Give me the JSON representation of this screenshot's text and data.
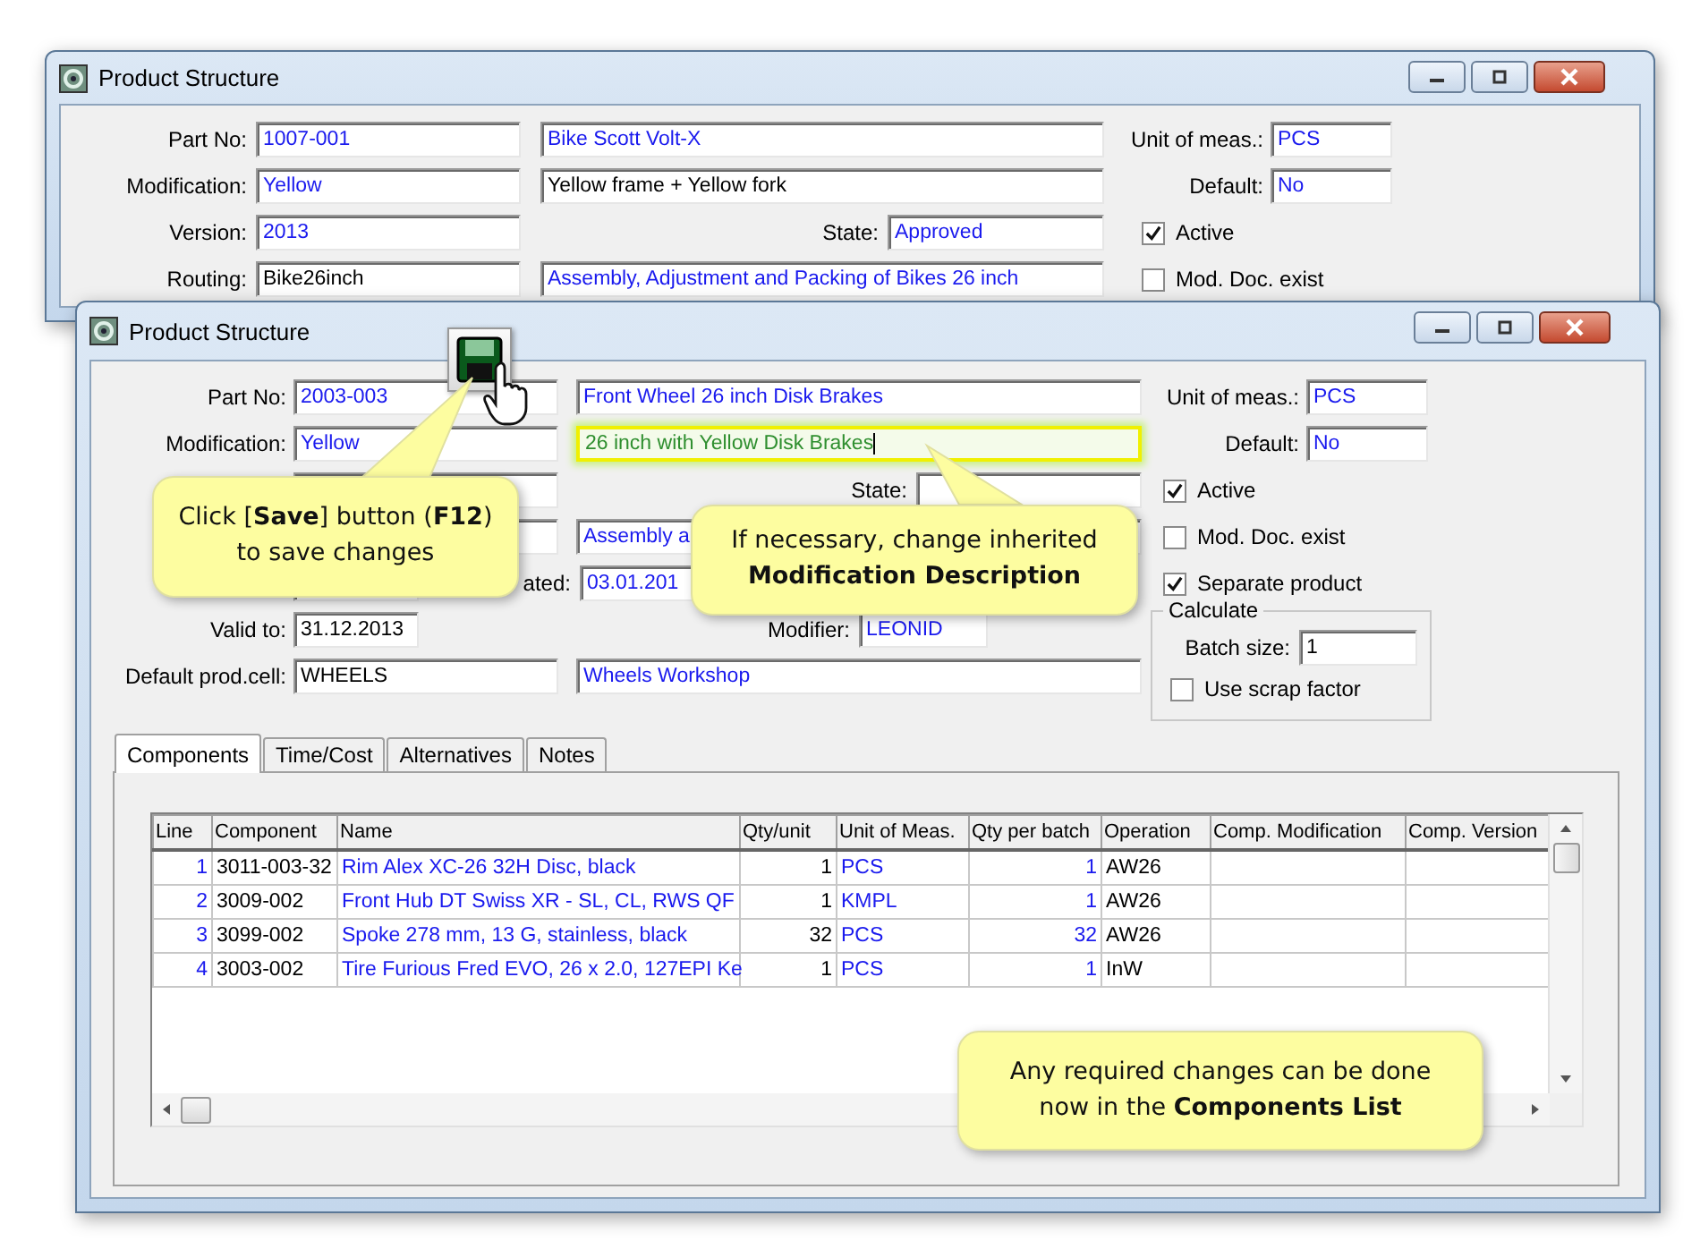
{
  "back_window": {
    "title": "Product Structure",
    "fields": {
      "part_no": {
        "label": "Part No:",
        "value": "1007-001",
        "kind": "lookup"
      },
      "part_name": {
        "value": "Bike Scott Volt-X",
        "kind": "lookup"
      },
      "unit": {
        "label": "Unit of meas.:",
        "value": "PCS",
        "kind": "lookup"
      },
      "modification": {
        "label": "Modification:",
        "value": "Yellow",
        "kind": "lookup"
      },
      "modification_description": {
        "value": "Yellow frame + Yellow fork",
        "kind": "text"
      },
      "default": {
        "label": "Default:",
        "value": "No",
        "kind": "lookup"
      },
      "version": {
        "label": "Version:",
        "value": "2013",
        "kind": "lookup"
      },
      "state": {
        "label": "State:",
        "value": "Approved",
        "kind": "lookup"
      },
      "routing": {
        "label": "Routing:",
        "value": "Bike26inch",
        "kind": "text"
      },
      "routing_description": {
        "value": "Assembly, Adjustment and Packing of Bikes 26 inch",
        "kind": "lookup"
      }
    },
    "checkboxes": [
      {
        "label": "Active",
        "checked": true
      },
      {
        "label": "Mod. Doc. exist",
        "checked": false
      }
    ]
  },
  "front_window": {
    "title": "Product Structure",
    "fields": {
      "part_no": {
        "label": "Part No:",
        "value": "2003-003",
        "kind": "lookup"
      },
      "part_name": {
        "value": "Front Wheel 26 inch Disk Brakes",
        "kind": "lookup"
      },
      "unit": {
        "label": "Unit of meas.:",
        "value": "PCS",
        "kind": "lookup"
      },
      "modification": {
        "label": "Modification:",
        "value": "Yellow",
        "kind": "lookup"
      },
      "modification_description": {
        "value": "26 inch with Yellow Disk Brakes",
        "kind": "highlighted"
      },
      "default": {
        "label": "Default:",
        "value": "No",
        "kind": "lookup"
      },
      "state": {
        "label": "State:"
      },
      "routing_description": {
        "value": "Assembly a",
        "kind": "lookup"
      },
      "created": {
        "label": "ated:",
        "value": "03.01.201",
        "kind": "lookup"
      },
      "valid_to": {
        "label": "Valid to:",
        "value": "31.12.2013",
        "kind": "text"
      },
      "modifier": {
        "label": "Modifier:",
        "value": "LEONID",
        "kind": "lookup"
      },
      "default_prod_cell": {
        "label": "Default prod.cell:",
        "value": "WHEELS",
        "kind": "text"
      },
      "prod_cell_name": {
        "value": "Wheels Workshop",
        "kind": "lookup"
      }
    },
    "checkboxes": [
      {
        "label": "Active",
        "checked": true
      },
      {
        "label": "Mod. Doc. exist",
        "checked": false
      },
      {
        "label": "Separate product",
        "checked": true
      }
    ],
    "calculate": {
      "title": "Calculate",
      "batch_size": {
        "label": "Batch size:",
        "value": "1"
      },
      "checkboxes": [
        {
          "label": "Use scrap factor",
          "checked": false
        }
      ]
    },
    "tabs": [
      {
        "label": "Components",
        "selected": true
      },
      {
        "label": "Time/Cost",
        "selected": false
      },
      {
        "label": "Alternatives",
        "selected": false
      },
      {
        "label": "Notes",
        "selected": false
      }
    ],
    "table": {
      "columns": [
        "Line",
        "Component",
        "Name",
        "Qty/unit",
        "Unit of Meas.",
        "Qty per batch",
        "Operation",
        "Comp. Modification",
        "Comp. Version"
      ],
      "rows": [
        {
          "line": "1",
          "component": "3011-003-32",
          "name": "Rim Alex XC-26 32H Disc, black",
          "qty_per_unit": "1",
          "unit": "PCS",
          "qty_per_batch": "1",
          "operation": "AW26"
        },
        {
          "line": "2",
          "component": "3009-002",
          "name": "Front Hub DT Swiss XR - SL, CL, RWS QF",
          "qty_per_unit": "1",
          "unit": "KMPL",
          "qty_per_batch": "1",
          "operation": "AW26"
        },
        {
          "line": "3",
          "component": "3099-002",
          "name": "Spoke 278 mm, 13 G, stainless, black",
          "qty_per_unit": "32",
          "unit": "PCS",
          "qty_per_batch": "32",
          "operation": "AW26"
        },
        {
          "line": "4",
          "component": "3003-002",
          "name": "Tire Furious Fred EVO, 26 x 2.0, 127EPI Ke",
          "qty_per_unit": "1",
          "unit": "PCS",
          "qty_per_batch": "1",
          "operation": "InW"
        }
      ]
    }
  },
  "callouts": [
    {
      "text": "Click [**Save**] button (**F12**) to save changes"
    },
    {
      "text": "If necessary, change inherited **Modification Description**"
    },
    {
      "text": "Any required changes can be done now in the **Components List**"
    }
  ]
}
